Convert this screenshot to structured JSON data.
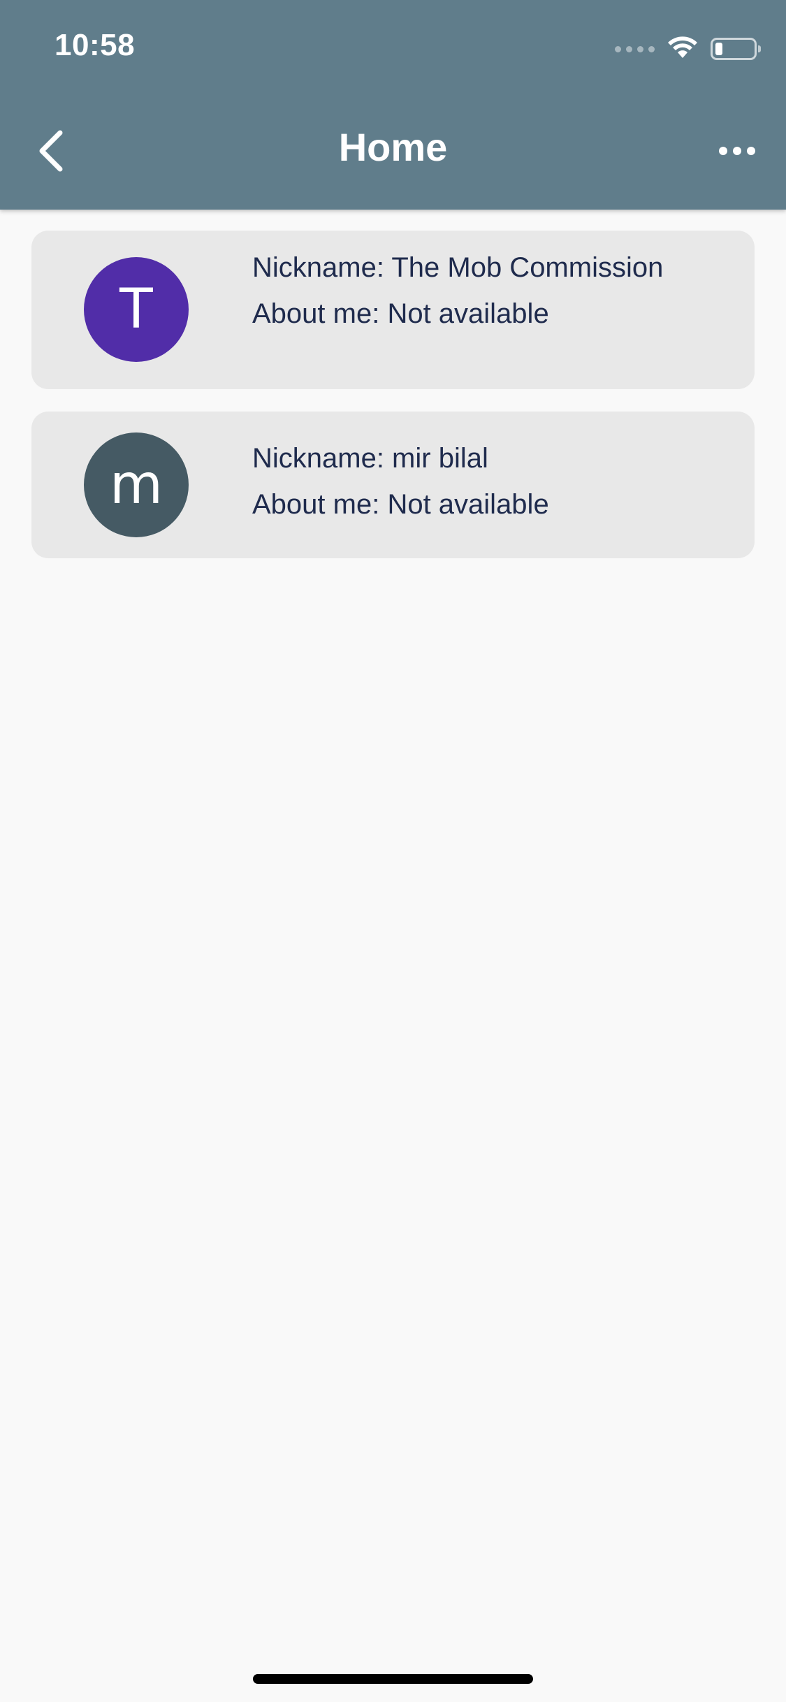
{
  "status_bar": {
    "time": "10:58",
    "wifi_icon": "wifi-icon",
    "battery_icon": "battery-icon",
    "battery_level": 0.2
  },
  "app_bar": {
    "title": "Home",
    "back_icon": "chevron-left-icon",
    "more_icon": "more-horizontal-icon",
    "background_color": "#607d8b"
  },
  "users": [
    {
      "avatar_letter": "T",
      "avatar_color": "#512da8",
      "nickname": "Nickname: The Mob Commission",
      "about": "About me: Not available"
    },
    {
      "avatar_letter": "m",
      "avatar_color": "#455a64",
      "nickname": "Nickname: mir bilal",
      "about": "About me: Not available"
    }
  ]
}
